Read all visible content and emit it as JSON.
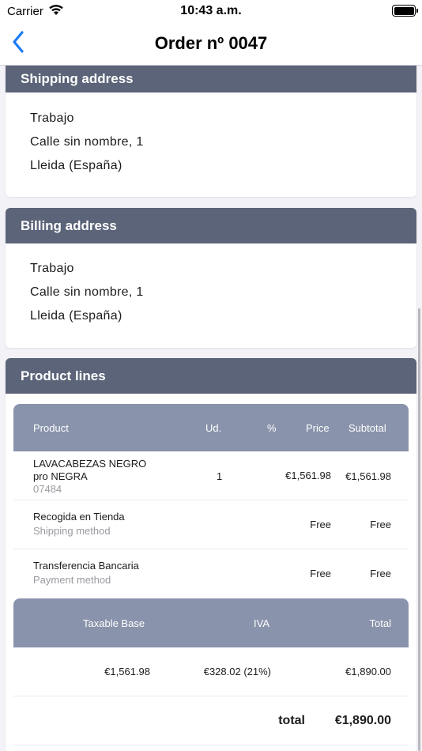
{
  "status_bar": {
    "carrier": "Carrier",
    "time": "10:43 a.m.",
    "icons": [
      "wifi-icon",
      "battery-icon"
    ]
  },
  "nav": {
    "back_icon": "chevron-left-icon",
    "title": "Order nº 0047",
    "accent": "#1a7cf5"
  },
  "shipping": {
    "header": "Shipping address",
    "lines": [
      "Trabajo",
      "Calle sin nombre, 1",
      "Lleida (España)"
    ]
  },
  "billing": {
    "header": "Billing address",
    "lines": [
      "Trabajo",
      "Calle sin nombre, 1",
      "Lleida (España)"
    ]
  },
  "products": {
    "header": "Product lines",
    "columns": [
      "Product",
      "Ud.",
      "%",
      "Price",
      "Subtotal"
    ],
    "rows": [
      {
        "name": "LAVACABEZAS NEGRO pro NEGRA",
        "sub": "07484",
        "qty": "1",
        "discount": "",
        "price": "€1,561.98",
        "subtotal": "€1,561.98"
      },
      {
        "name": "Recogida en Tienda",
        "sub": "Shipping method",
        "qty": "",
        "discount": "",
        "price": "Free",
        "subtotal": "Free"
      },
      {
        "name": "Transferencia Bancaria",
        "sub": "Payment method",
        "qty": "",
        "discount": "",
        "price": "Free",
        "subtotal": "Free"
      }
    ],
    "summary_columns": [
      "Taxable Base",
      "IVA",
      "Total"
    ],
    "summary_values": [
      "€1,561.98",
      "€328.02 (21%)",
      "€1,890.00"
    ],
    "total_label": "total",
    "total_value": "€1,890.00"
  },
  "colors": {
    "card_header": "#5b6478",
    "table_header": "#8993ab"
  }
}
